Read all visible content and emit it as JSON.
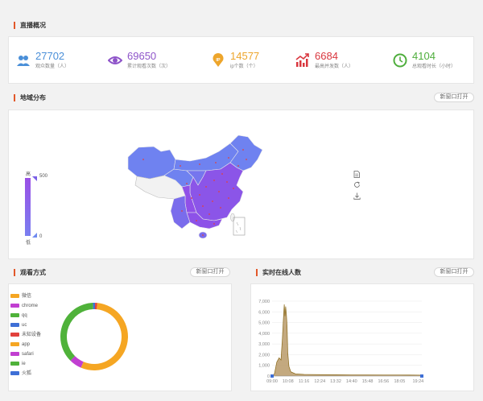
{
  "overview": {
    "title": "直播概况",
    "stats": [
      {
        "value": "27702",
        "label": "观众数量（人）",
        "color": "#4a8fd8",
        "icon": "users-icon"
      },
      {
        "value": "69650",
        "label": "累计观看次数（次）",
        "color": "#8e54c9",
        "icon": "eye-icon"
      },
      {
        "value": "14577",
        "label": "ip个数（个）",
        "color": "#eda52b",
        "icon": "ip-pin-icon"
      },
      {
        "value": "6684",
        "label": "最高并发数（人）",
        "color": "#d9363e",
        "icon": "trend-up-icon"
      },
      {
        "value": "4104",
        "label": "总观看时长（小时）",
        "color": "#4fae3d",
        "icon": "clock-icon"
      }
    ]
  },
  "region": {
    "title": "地域分布",
    "open_label": "新窗口打开",
    "scale_high": "高",
    "scale_low": "低",
    "scale_max": "500",
    "scale_min": "0"
  },
  "watch_mode": {
    "title": "观看方式",
    "open_label": "新窗口打开",
    "legend": [
      {
        "label": "微信",
        "color": "#f5a623"
      },
      {
        "label": "chrome",
        "color": "#c13fd1"
      },
      {
        "label": "qq",
        "color": "#4fb23a"
      },
      {
        "label": "uc",
        "color": "#3e6fd6"
      },
      {
        "label": "未知设备",
        "color": "#e2413c"
      },
      {
        "label": "app",
        "color": "#f5a623"
      },
      {
        "label": "safari",
        "color": "#c13fd1"
      },
      {
        "label": "ie",
        "color": "#4fb23a"
      },
      {
        "label": "火狐",
        "color": "#3e6fd6"
      }
    ]
  },
  "realtime": {
    "title": "实时在线人数",
    "open_label": "新窗口打开"
  },
  "chart_data": [
    {
      "type": "pie",
      "title": "",
      "labels": [
        "微信",
        "chrome",
        "qq",
        "uc",
        "未知设备",
        "app",
        "safari",
        "ie",
        "火狐"
      ],
      "values": [
        55,
        6,
        37,
        1,
        1,
        0,
        0,
        0,
        0
      ],
      "colors": [
        "#f5a623",
        "#c13fd1",
        "#4fb23a",
        "#3e6fd6",
        "#e2413c",
        "#f5a623",
        "#c13fd1",
        "#4fb23a",
        "#3e6fd6"
      ]
    },
    {
      "type": "area",
      "title": "",
      "xlabel": "",
      "ylabel": "",
      "y_ticks": [
        0,
        1000,
        2000,
        3000,
        4000,
        5000,
        6000,
        7000
      ],
      "y_tick_labels": [
        "0",
        "1,000",
        "2,000",
        "3,000",
        "4,000",
        "5,000",
        "6,000",
        "7,000"
      ],
      "ylim": [
        0,
        7300
      ],
      "x_ticks": [
        "09:00",
        "10:08",
        "11:16",
        "12:24",
        "13:32",
        "14:40",
        "15:48",
        "16:56",
        "18:05",
        "19:24"
      ],
      "x_domain": [
        "09:00",
        "19:40"
      ],
      "points": [
        [
          "09:00",
          0
        ],
        [
          "09:10",
          200
        ],
        [
          "09:20",
          1300
        ],
        [
          "09:30",
          1700
        ],
        [
          "09:38",
          1500
        ],
        [
          "09:44",
          3500
        ],
        [
          "09:48",
          5200
        ],
        [
          "09:52",
          6700
        ],
        [
          "09:55",
          5600
        ],
        [
          "09:58",
          6500
        ],
        [
          "10:01",
          5800
        ],
        [
          "10:04",
          4700
        ],
        [
          "10:07",
          2200
        ],
        [
          "10:12",
          900
        ],
        [
          "10:20",
          400
        ],
        [
          "10:40",
          200
        ],
        [
          "11:16",
          150
        ],
        [
          "12:24",
          130
        ],
        [
          "13:32",
          120
        ],
        [
          "14:40",
          110
        ],
        [
          "15:48",
          110
        ],
        [
          "16:56",
          100
        ],
        [
          "18:05",
          100
        ],
        [
          "19:24",
          90
        ],
        [
          "19:40",
          80
        ]
      ],
      "fill": "#b89a68",
      "stroke": "#8b6a1a"
    }
  ]
}
